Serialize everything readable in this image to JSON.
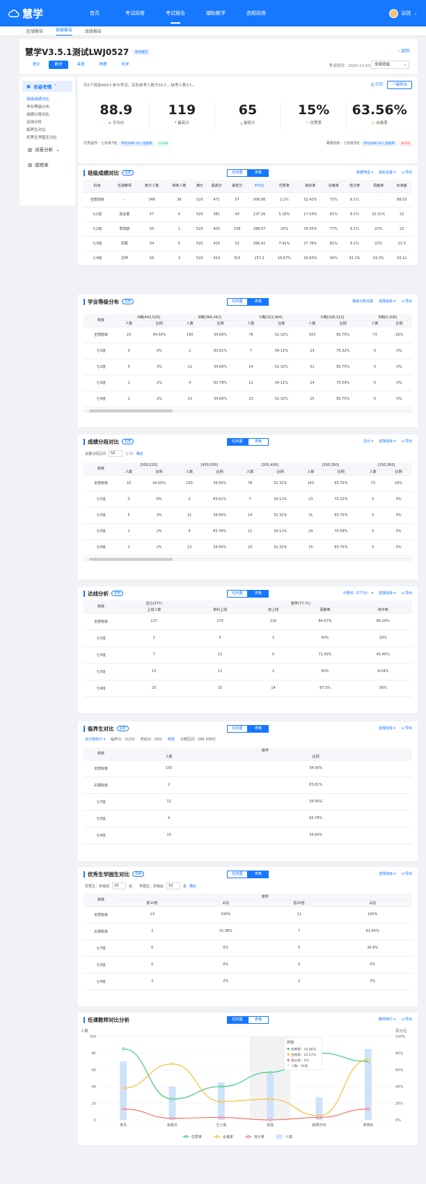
{
  "brand": "慧学",
  "nav": [
    "首页",
    "考试阅卷",
    "考试报告",
    "辅助教学",
    "选题阅卷"
  ],
  "user": "谈锐",
  "subnav": [
    "区域报告",
    "校级报告",
    "班级报告"
  ],
  "title": "慧学V3.5.1测试LWJ0527",
  "title_tag": "联考报告",
  "back": "返回",
  "subjects": [
    "语文",
    "数学",
    "英语",
    "物理",
    "化学"
  ],
  "exam_time": "考试时间：2020-11-03",
  "class_select": "全部班级",
  "sidebar": {
    "head": "年级考情",
    "items": [
      "班级成绩对比",
      "学业等级分布",
      "成绩分段对比",
      "达线分析",
      "临界生对比",
      "优秀生学困生对比"
    ],
    "groups": [
      "试卷分析",
      "成绩单"
    ]
  },
  "overview": {
    "desc": "共5个班级489人参与考试，实际参考人数为55人，缺考人数3人。",
    "print": "打印",
    "export": "一键导出",
    "stats": [
      {
        "v": "88.9",
        "l": "平均分"
      },
      {
        "v": "119",
        "l": "最高分"
      },
      {
        "v": "65",
        "l": "最低分"
      },
      {
        "v": "15%",
        "l": "优秀率"
      },
      {
        "v": "63.56%",
        "l": "合格率"
      }
    ],
    "left_foot": "优秀临界：七年级7班",
    "left_p1": "平均分86.12 | 合格率",
    "left_p2": "+10分",
    "right_foot": "薄弱班级：七年级3班",
    "right_p1": "平均分80.16 | 及格率",
    "right_p2": "-8.5分"
  },
  "s1": {
    "title": "班级成绩对比",
    "badge": "说明",
    "tog": [
      "柱状图",
      "表格"
    ],
    "tools": [
      "数据筛选 ▾",
      "指标设置 ▾",
      "导出"
    ],
    "headers": [
      "科目",
      "任课教师",
      "统计人数",
      "缺考人数",
      "满分",
      "最高分",
      "最低分",
      "平均分",
      "优秀率",
      "良好率",
      "合格率",
      "低分率",
      "贡献率",
      "标准差"
    ],
    "rows": [
      [
        "全部班级",
        "-",
        "348",
        "38",
        "520",
        "471",
        "57",
        "308.96",
        "2.2%",
        "52.42%",
        "73%",
        "8.1%",
        "-",
        "88.03"
      ],
      [
        "七1班",
        "张必勇",
        "57",
        "4",
        "520",
        "381",
        "43",
        "237.26",
        "5.26%",
        "17.54%",
        "81%",
        "8.1%",
        "22.31%",
        "22"
      ],
      [
        "七2班",
        "李政航",
        "55",
        "1",
        "520",
        "405",
        "158",
        "288.07",
        "20%",
        "34.55%",
        "77%",
        "8.1%",
        "22%",
        "22"
      ],
      [
        "七3班",
        "闻霄",
        "54",
        "5",
        "520",
        "420",
        "53",
        "266.41",
        "7.41%",
        "27.78%",
        "82%",
        "8.1%",
        "22%",
        "22.3"
      ],
      [
        "七4班",
        "沈萍",
        "56",
        "3",
        "520",
        "414",
        "315",
        "257.2",
        "16.67%",
        "29.83%",
        "34%",
        "42.1%",
        "43.3%",
        "43.12"
      ]
    ]
  },
  "s2": {
    "title": "学业等级分布",
    "badge": "说明",
    "tog": [
      "柱状图",
      "表格"
    ],
    "tools": [
      "等级分数设置",
      "选择班级 ▾",
      "导出"
    ],
    "groups": [
      "A等[442,520]",
      "B等[364,442]",
      "C等[312,364]",
      "D等[208,312]",
      "E等[0,208]"
    ],
    "sub": [
      "人数",
      "比例"
    ],
    "first": "班级",
    "rows": [
      [
        "全部班级",
        "10",
        "34.00%",
        "150",
        "34.00%",
        "78",
        "52.32%",
        "143",
        "65.75%",
        "73",
        "16%"
      ],
      [
        "七1班",
        "0",
        "0%",
        "2",
        "83.61%",
        "7",
        "34.11%",
        "23",
        "70.32%",
        "0",
        "0%"
      ],
      [
        "七2班",
        "5",
        "3%",
        "11",
        "34.00%",
        "14",
        "52.32%",
        "31",
        "65.75%",
        "0",
        "0%"
      ],
      [
        "七3班",
        "1",
        "2%",
        "4",
        "83.78%",
        "11",
        "34.11%",
        "24",
        "70.59%",
        "0",
        "0%"
      ],
      [
        "七4班",
        "2",
        "2%",
        "13",
        "34.00%",
        "23",
        "52.32%",
        "15",
        "65.75%",
        "0",
        "0%"
      ]
    ]
  },
  "s3": {
    "title": "成绩分段对比",
    "badge": "说明",
    "tog": [
      "柱状图",
      "表格"
    ],
    "tools": [
      "总分 ▾",
      "选择班级 ▾",
      "导出"
    ],
    "cfg_label": "设置分段区间",
    "cfg_val": "50",
    "cfg_unit": "分/段",
    "cfg_ok": "确定",
    "groups": [
      "[500,520]",
      "[450,500]",
      "[350,400]",
      "[300,350]",
      "[250,300]"
    ],
    "sub": [
      "人数",
      "比例"
    ],
    "first": "班级",
    "rows": [
      [
        "全部班级",
        "10",
        "34.00%",
        "150",
        "34.00%",
        "78",
        "52.32%",
        "143",
        "65.75%",
        "73",
        "16%"
      ],
      [
        "七1班",
        "0",
        "0%",
        "2",
        "83.61%",
        "7",
        "34.11%",
        "23",
        "70.32%",
        "0",
        "0%"
      ],
      [
        "七2班",
        "5",
        "3%",
        "11",
        "34.00%",
        "14",
        "52.32%",
        "31",
        "65.75%",
        "0",
        "0%"
      ],
      [
        "七3班",
        "1",
        "2%",
        "4",
        "83.78%",
        "11",
        "34.11%",
        "24",
        "70.59%",
        "0",
        "0%"
      ],
      [
        "七4班",
        "2",
        "2%",
        "13",
        "34.00%",
        "23",
        "52.32%",
        "15",
        "65.75%",
        "0",
        "0%"
      ]
    ]
  },
  "s4": {
    "title": "达线分析",
    "badge": "说明",
    "tog": [
      "柱状图",
      "表格"
    ],
    "tools": [
      "分数线（377分） ▾",
      "选择班级 ▾",
      "导出"
    ],
    "first": "班级",
    "g1": "总分(377)",
    "g1sub": "上线人数",
    "g2": "数学(77.71)",
    "g2sub": [
      "单科上线",
      "双上线",
      "贡献率",
      "命中率"
    ],
    "rows": [
      [
        "全部班级",
        "137",
        "175",
        "116",
        "84.67%",
        "66.29%"
      ],
      [
        "七1班",
        "2",
        "5",
        "1",
        "50%",
        "20%"
      ],
      [
        "七2班",
        "7",
        "11",
        "5",
        "71.43%",
        "45.45%"
      ],
      [
        "七3班",
        "13",
        "11",
        "1",
        "50%",
        "9.09%"
      ],
      [
        "七4班",
        "25",
        "25",
        "14",
        "87.5%",
        "56%"
      ]
    ]
  },
  "s5": {
    "title": "临界生对比",
    "badge": "说明",
    "tog": [
      "柱状图",
      "表格"
    ],
    "tools": [
      "选择班级 ▾",
      "导出"
    ],
    "cfg": [
      "全分数统计 ▾",
      "临界分：312分",
      "浮动分：26分",
      "修改",
      "分数区间：286-338分"
    ],
    "first": "班级",
    "group": "数学",
    "sub": [
      "人数",
      "比例"
    ],
    "rows": [
      [
        "全部班级",
        "150",
        "34.00%"
      ],
      [
        "尖端班级",
        "2",
        "83.61%"
      ],
      [
        "七7班",
        "11",
        "34.00%"
      ],
      [
        "七3班",
        "4",
        "83.78%"
      ],
      [
        "七4班",
        "13",
        "34.00%"
      ]
    ]
  },
  "s6": {
    "title": "优秀生学困生对比",
    "badge": "说明",
    "tog": [
      "柱状图",
      "表格"
    ],
    "tools": [
      "选择班级 ▾",
      "导出"
    ],
    "cfg": [
      "优秀生：年级前",
      "10",
      "名",
      "学困生：年级后",
      "10",
      "名",
      "确定"
    ],
    "first": "班级",
    "group": "数学",
    "sub": [
      "前10名",
      "占比",
      "后10名",
      "占比"
    ],
    "rows": [
      [
        "全部班级",
        "13",
        "100%",
        "11",
        "100%"
      ],
      [
        "尖端班级",
        "2",
        "15.38%",
        "7",
        "63.45%"
      ],
      [
        "七7班",
        "0",
        "0%",
        "5",
        "36.6%"
      ],
      [
        "七3班",
        "0",
        "0%",
        "0",
        "0%"
      ],
      [
        "七4班",
        "2",
        "2%",
        "2",
        "2%"
      ]
    ]
  },
  "s7": {
    "title": "任课教师对比分析",
    "tog": [
      "柱状图",
      "表格"
    ],
    "tools": [
      "教师排行 ▾",
      "导出"
    ],
    "yl": "人数",
    "yr": "百分比",
    "tooltip": {
      "title": "孙强",
      "rows": [
        "优秀率：56.86%",
        "合格率：24.57%",
        "低分率：0%",
        "人数：54名"
      ]
    },
    "legend": [
      "优秀率",
      "合格率",
      "低分率",
      "人数"
    ]
  },
  "chart_data": {
    "type": "bar",
    "categories": [
      "李丹",
      "张晨文",
      "王小雯",
      "孙强",
      "欧阳可可",
      "李明东"
    ],
    "ylim_left": [
      0,
      100
    ],
    "yticks_left": [
      0,
      20,
      40,
      60,
      80,
      100
    ],
    "ylim_right": [
      0,
      100
    ],
    "yticks_right": [
      "0%",
      "20%",
      "40%",
      "60%",
      "80%",
      "100%"
    ],
    "series": [
      {
        "name": "人数",
        "type": "bar",
        "values": [
          70,
          40,
          45,
          55,
          27,
          85
        ]
      },
      {
        "name": "优秀率",
        "type": "line",
        "values": [
          85,
          25,
          40,
          57,
          80,
          70
        ]
      },
      {
        "name": "合格率",
        "type": "line",
        "values": [
          38,
          67,
          22,
          25,
          5,
          72
        ]
      },
      {
        "name": "低分率",
        "type": "line",
        "values": [
          13,
          2,
          3,
          0,
          3,
          13
        ]
      }
    ],
    "colors": {
      "人数": "#cfe2fb",
      "优秀率": "#2dc76d",
      "合格率": "#f5b82e",
      "低分率": "#f06a5e"
    }
  }
}
